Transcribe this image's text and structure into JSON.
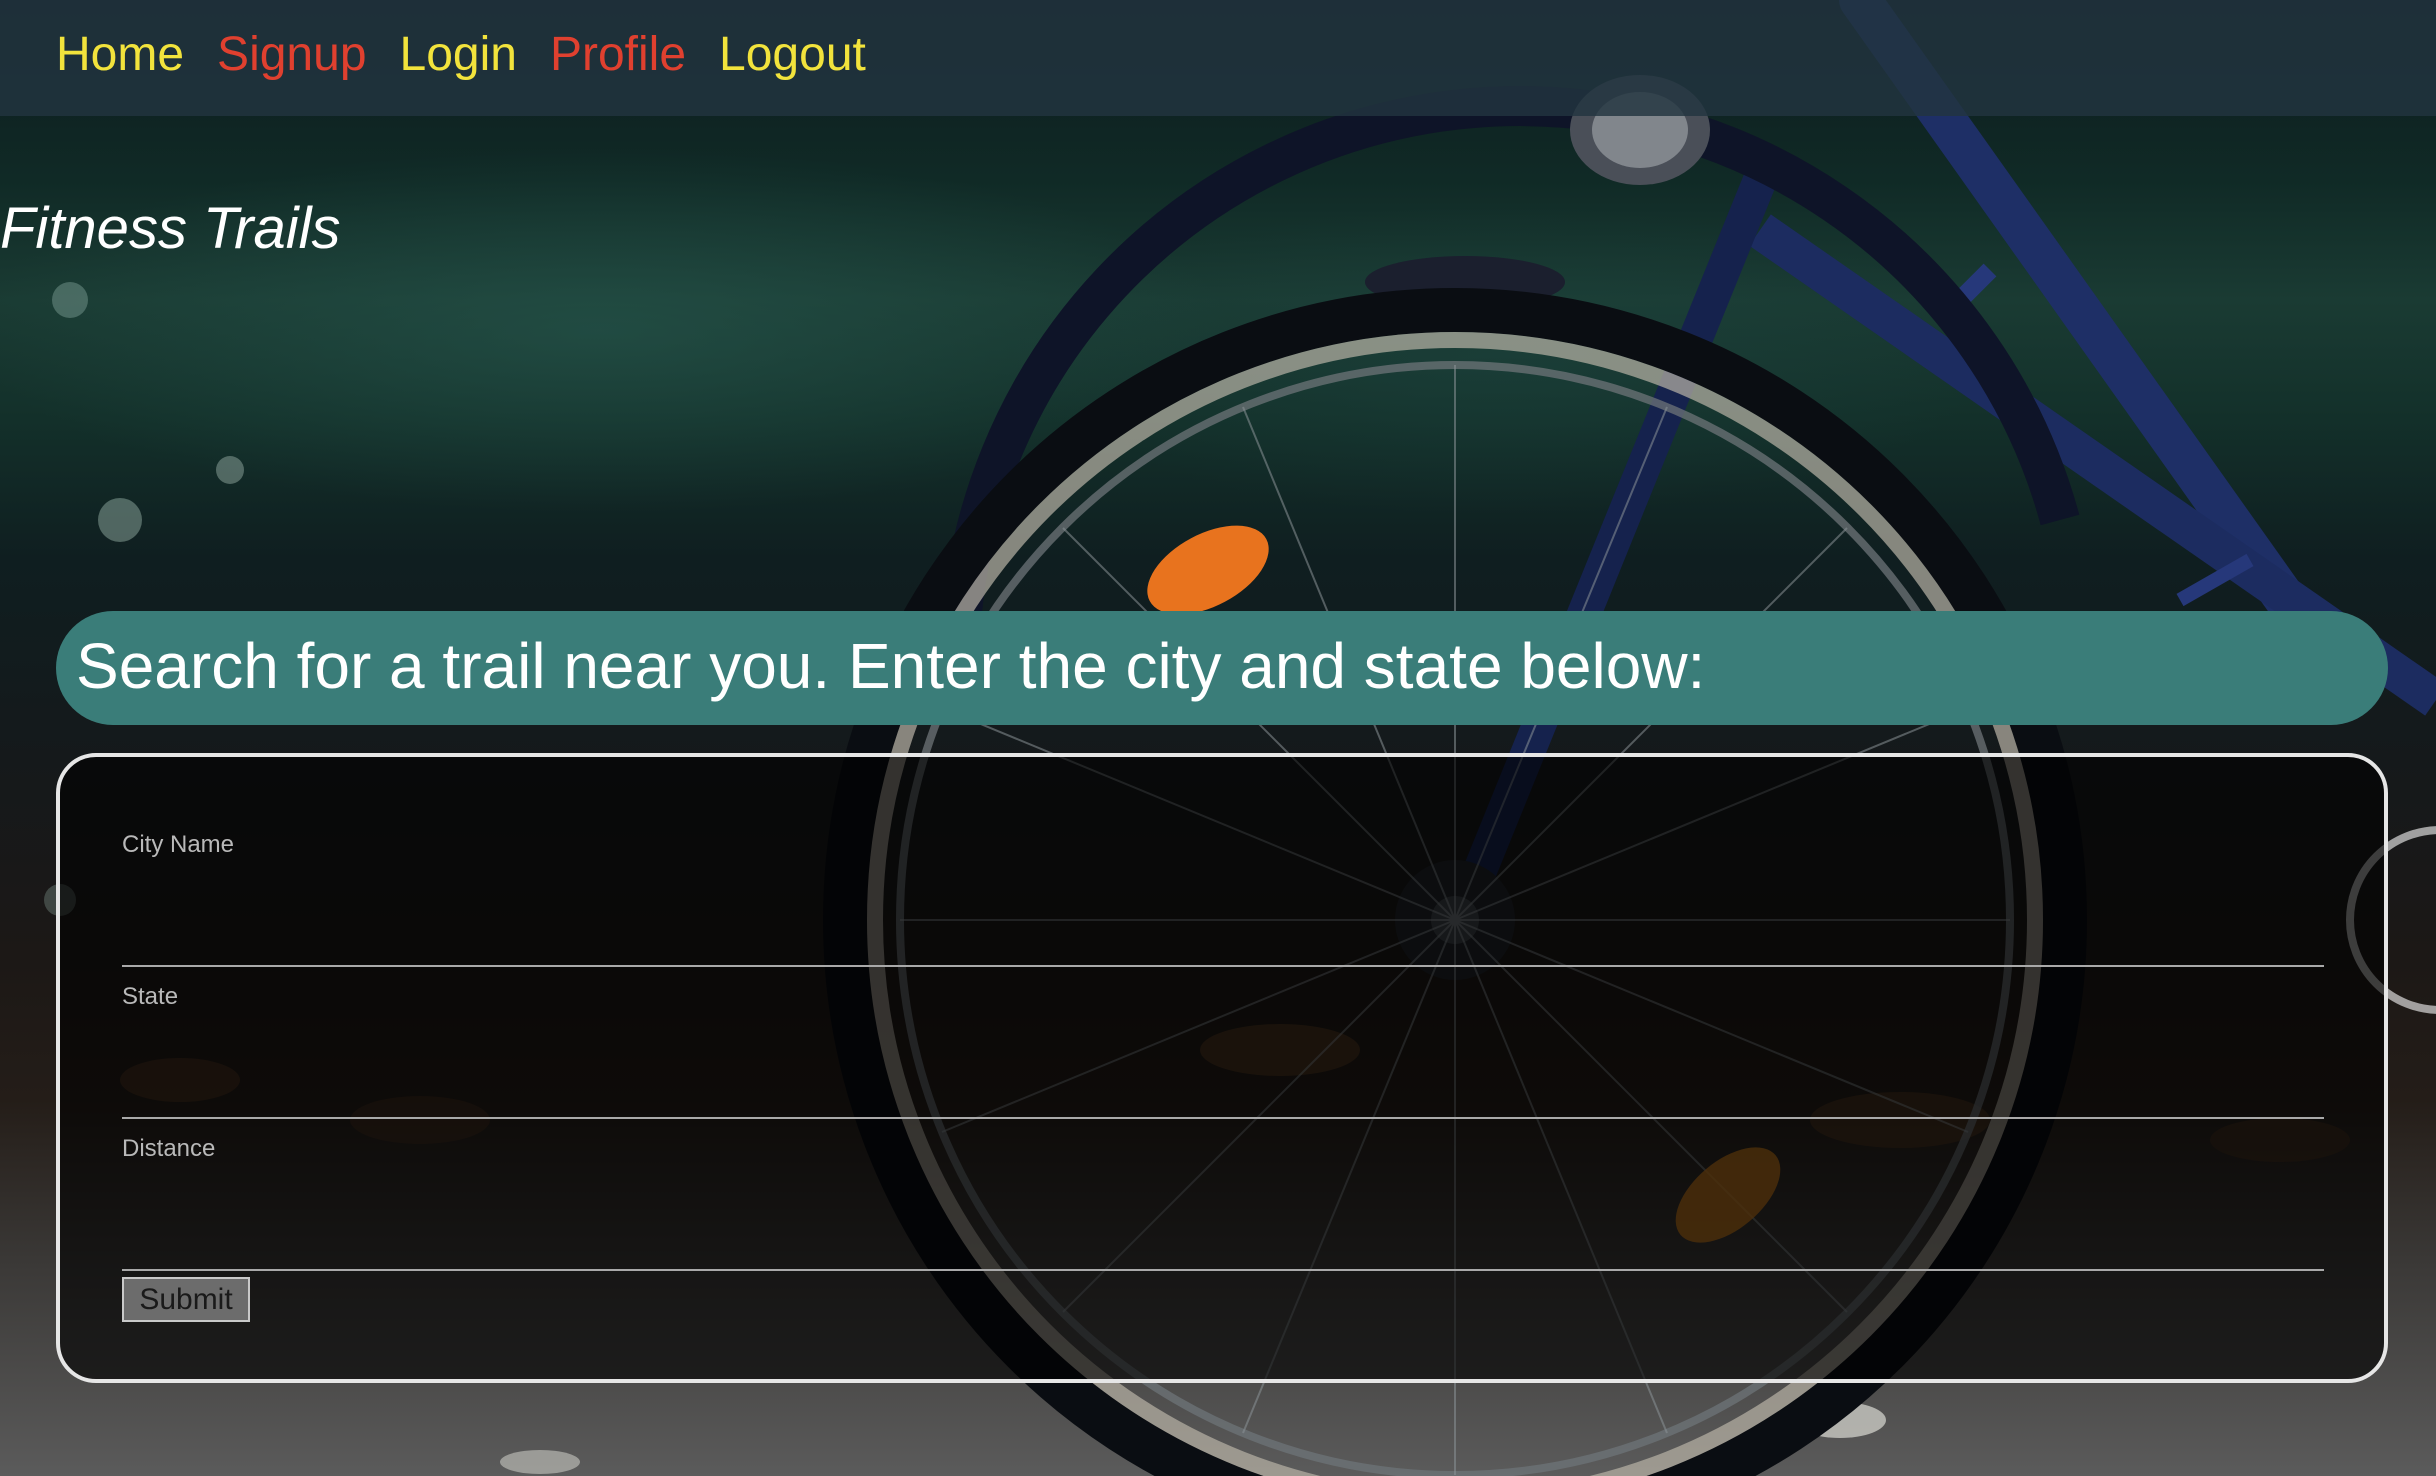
{
  "nav": {
    "links": [
      {
        "label": "Home",
        "color": "#f2e33c"
      },
      {
        "label": "Signup",
        "color": "#e0402f"
      },
      {
        "label": "Login",
        "color": "#f2e33c"
      },
      {
        "label": "Profile",
        "color": "#e0402f"
      },
      {
        "label": "Logout",
        "color": "#f2e33c"
      }
    ]
  },
  "page": {
    "title": "Fitness Trails"
  },
  "search": {
    "heading": "Search for a trail near you. Enter the city and state below:",
    "heading_background": "#3a7d79",
    "fields": [
      {
        "label": "City Name",
        "value": ""
      },
      {
        "label": "State",
        "value": ""
      },
      {
        "label": "Distance",
        "value": ""
      }
    ],
    "submit_label": "Submit"
  },
  "background": {
    "subject": "bicycle-wheel-photo"
  }
}
